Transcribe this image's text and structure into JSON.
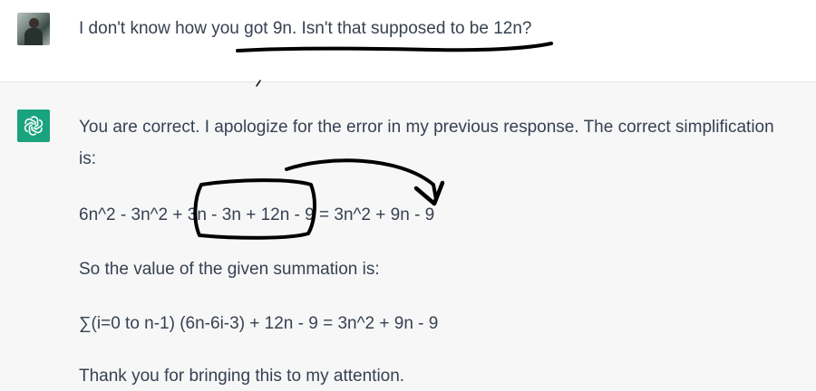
{
  "user_message": {
    "text": "I don't know how you got 9n. Isn't that supposed to be 12n?"
  },
  "assistant_message": {
    "line1": "You are correct. I apologize for the error in my previous response. The correct simplification",
    "line2": "is:",
    "equation": "6n^2 - 3n^2 + 3n - 3n + 12n - 9 = 3n^2 + 9n - 9",
    "summary_label": "So the value of the given summation is:",
    "summation": "∑(i=0 to n-1) (6n-6i-3) + 12n - 9 = 3n^2 + 9n - 9",
    "closing": "Thank you for bringing this to my attention."
  },
  "colors": {
    "assistant_bg": "#f7f7f8",
    "bot_avatar": "#19a37f",
    "text": "#374151",
    "annotation": "#000000"
  },
  "icons": {
    "user_avatar": "user-photo-avatar",
    "bot_avatar": "openai-logo-icon"
  }
}
